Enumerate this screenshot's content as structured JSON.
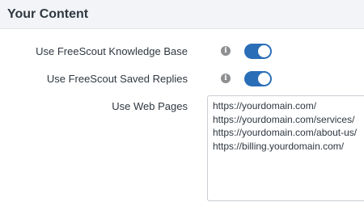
{
  "section": {
    "title": "Your Content"
  },
  "settings": [
    {
      "label": "Use FreeScout Knowledge Base",
      "info_icon": "info-icon",
      "toggle_on": true
    },
    {
      "label": "Use FreeScout Saved Replies",
      "info_icon": "info-icon",
      "toggle_on": true
    }
  ],
  "web_pages": {
    "label": "Use Web Pages",
    "value": "https://yourdomain.com/\nhttps://yourdomain.com/services/\nhttps://yourdomain.com/about-us/\nhttps://billing.yourdomain.com/"
  },
  "colors": {
    "toggle_on": "#2a6eb8",
    "header_bg": "#f2f4f7",
    "info_icon": "#8d8f91"
  }
}
